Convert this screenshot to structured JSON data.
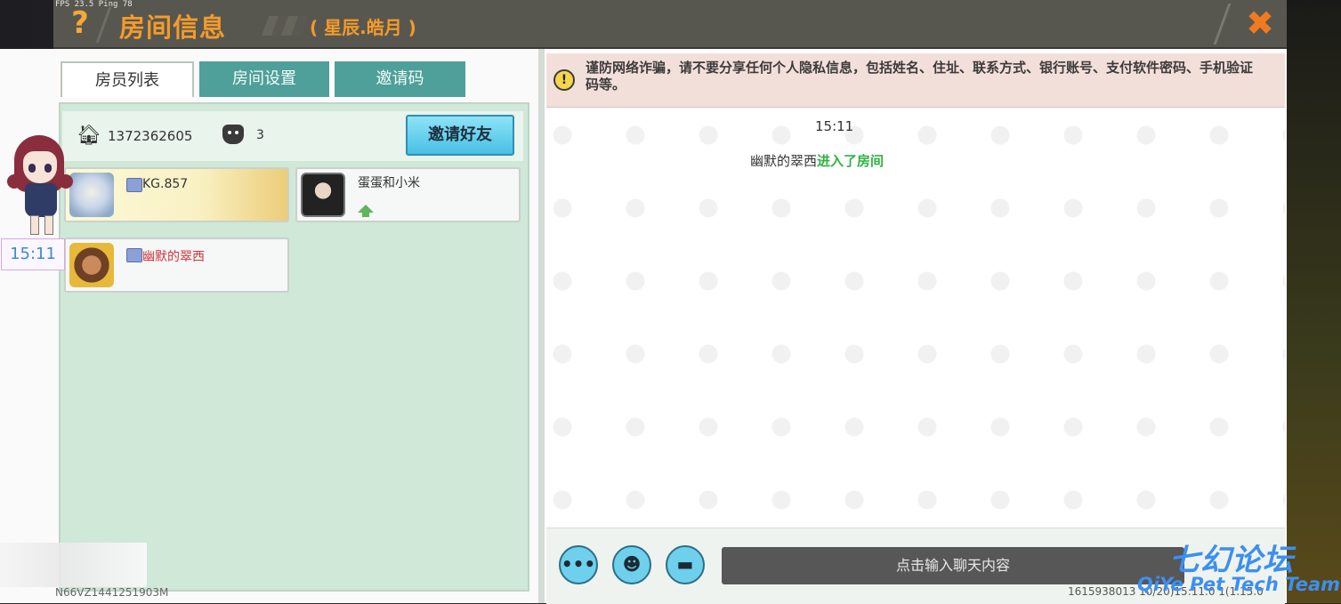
{
  "window": {
    "fps_ping": "FPS 23.5  Ping 78",
    "title": "房间信息",
    "subtitle": "( 星辰.皓月 )",
    "help_glyph": "?",
    "close_glyph": "✖"
  },
  "tabs": [
    {
      "label": "房员列表",
      "active": true
    },
    {
      "label": "房间设置",
      "active": false
    },
    {
      "label": "邀请码",
      "active": false
    }
  ],
  "room": {
    "id": "1372362605",
    "member_count": "3",
    "invite_button": "邀请好友"
  },
  "members": [
    {
      "name": "KG.857",
      "name_color": "#333333",
      "highlight": true,
      "has_crown": true
    },
    {
      "name": "蛋蛋和小米",
      "name_color": "#333333",
      "highlight": false,
      "has_crown": false,
      "has_vip_arrow": true
    },
    {
      "name": "幽默的翠西",
      "name_color": "#d2343a",
      "highlight": false,
      "has_crown": true
    }
  ],
  "left_footer_id": "N66VZ1441251903M",
  "side_time": "15:11",
  "chat": {
    "warning_icon": "!",
    "warning": "谨防网络诈骗，请不要分享任何个人隐私信息，包括姓名、住址、联系方式、银行账号、支付软件密码、手机验证码等。",
    "time": "15:11",
    "message_user": "幽默的翠西",
    "message_action": "进入了房间",
    "input_placeholder": "点击输入聊天内容",
    "footer_id": "1615938013   10/20)15:11.0   1(1.15.0",
    "buttons": [
      {
        "icon": "more-icon",
        "glyph": "•••"
      },
      {
        "icon": "emoji-icon",
        "glyph": "☻"
      },
      {
        "icon": "keyboard-icon",
        "glyph": "▬"
      }
    ]
  },
  "watermark": {
    "cn": "七幻论坛",
    "en": "QiYe Pet Tech Team"
  },
  "colors": {
    "accent_orange": "#f39b2b",
    "tab_teal": "#4f9f9a",
    "invite_blue": "#48c0e5",
    "action_green": "#2fb242"
  }
}
